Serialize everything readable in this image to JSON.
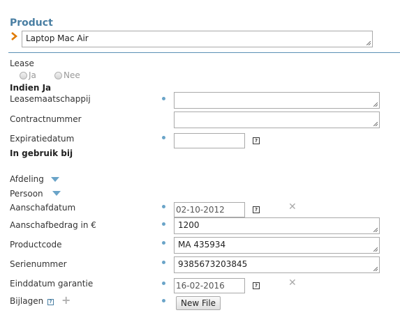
{
  "header": {
    "clipped_text": "··· ··· ···"
  },
  "product": {
    "title": "Product",
    "value": "Laptop Mac Air"
  },
  "lease": {
    "label": "Lease",
    "options": [
      "Ja",
      "Nee"
    ],
    "if_yes_heading": "Indien Ja",
    "leasemaatschappij_label": "Leasemaatschappij",
    "leasemaatschappij_value": "",
    "contractnummer_label": "Contractnummer",
    "contractnummer_value": "",
    "expiratiedatum_label": "Expiratiedatum",
    "expiratiedatum_value": ""
  },
  "in_use": {
    "heading": "In gebruik bij",
    "afdeling_label": "Afdeling",
    "persoon_label": "Persoon"
  },
  "fields": {
    "aanschafdatum_label": "Aanschafdatum",
    "aanschafdatum_value": "02-10-2012",
    "aanschafbedrag_label": "Aanschafbedrag in €",
    "aanschafbedrag_value": "1200",
    "productcode_label": "Productcode",
    "productcode_value": "MA 435934",
    "serienummer_label": "Serienummer",
    "serienummer_value": "9385673203845",
    "einddatum_label": "Einddatum garantie",
    "einddatum_value": "16-02-2016",
    "bijlagen_label": "Bijlagen",
    "new_file_button": "New File"
  },
  "icons": {
    "calendar": "calendar-icon",
    "clear": "clear-icon",
    "dropdown": "triangle-down-icon",
    "help": "help-icon",
    "add": "plus-icon",
    "expand": "chevron-right-icon"
  },
  "colors": {
    "accent": "#4a7fa3",
    "required_dot": "#6aa4c8",
    "chevron": "#e07a00",
    "divider": "#5a90b5"
  }
}
